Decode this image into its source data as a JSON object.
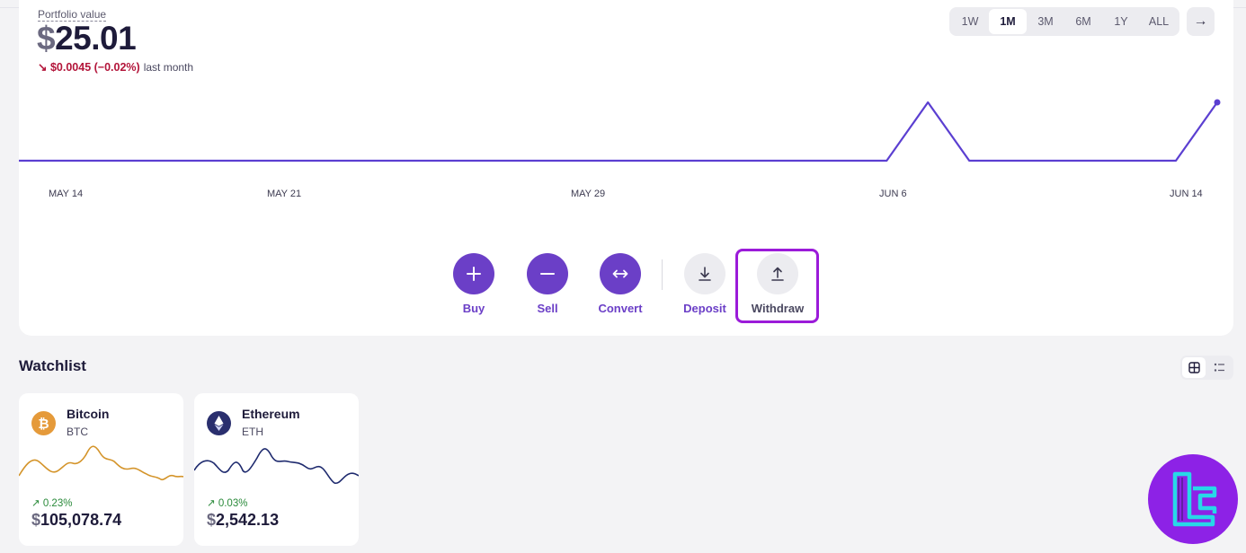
{
  "portfolio": {
    "label": "Portfolio value",
    "currency_symbol": "$",
    "value": "25.01",
    "change_arrow": "↘",
    "change": "$0.0045 (−0.02%)",
    "change_period": "last month"
  },
  "time_ranges": [
    "1W",
    "1M",
    "3M",
    "6M",
    "1Y",
    "ALL"
  ],
  "active_range": "1M",
  "next_icon": "→",
  "chart_data": {
    "type": "line",
    "x": [
      "MAY 14",
      "MAY 21",
      "MAY 29",
      "JUN 6",
      "JUN 14"
    ],
    "points_note_free": true,
    "values": [
      0,
      0,
      0,
      0,
      0,
      0,
      0,
      0,
      0,
      0,
      0,
      0,
      0,
      0,
      0,
      0,
      0,
      0,
      0,
      0,
      0,
      0,
      1,
      0,
      0,
      0,
      0,
      0,
      0,
      1
    ],
    "color": "#5b3fd1"
  },
  "actions": {
    "buy": "Buy",
    "sell": "Sell",
    "convert": "Convert",
    "deposit": "Deposit",
    "withdraw": "Withdraw"
  },
  "watchlist": {
    "title": "Watchlist",
    "items": [
      {
        "name": "Bitcoin",
        "symbol": "BTC",
        "change_arrow": "↗",
        "change": "0.23%",
        "currency_symbol": "$",
        "price": "105,078.74",
        "color": "#d4942a",
        "icon": "bitcoin-icon"
      },
      {
        "name": "Ethereum",
        "symbol": "ETH",
        "change_arrow": "↗",
        "change": "0.03%",
        "currency_symbol": "$",
        "price": "2,542.13",
        "color": "#1e2a6e",
        "icon": "ethereum-icon"
      }
    ]
  },
  "colors": {
    "accent": "#6b3fc7",
    "negative": "#b3153a",
    "positive": "#2a8a3a",
    "highlight": "#9b1bd9"
  }
}
